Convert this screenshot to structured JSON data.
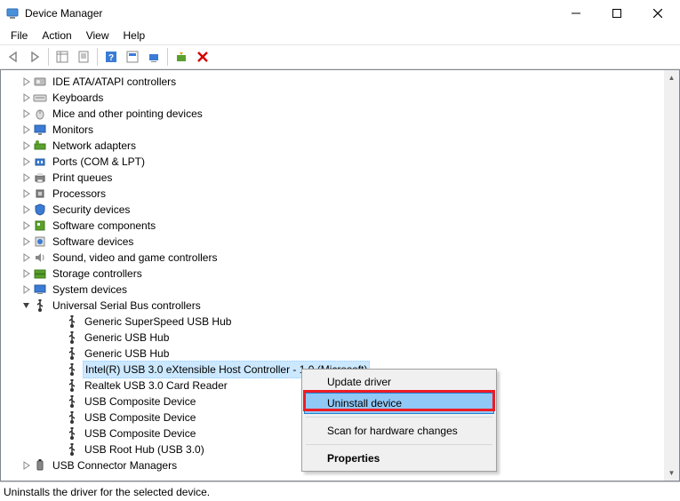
{
  "window": {
    "title": "Device Manager"
  },
  "menu": {
    "file": "File",
    "action": "Action",
    "view": "View",
    "help": "Help"
  },
  "tree": {
    "categories": [
      {
        "label": "IDE ATA/ATAPI controllers",
        "icon": "drive",
        "expanded": false
      },
      {
        "label": "Keyboards",
        "icon": "keyboard",
        "expanded": false
      },
      {
        "label": "Mice and other pointing devices",
        "icon": "mouse",
        "expanded": false
      },
      {
        "label": "Monitors",
        "icon": "monitor",
        "expanded": false
      },
      {
        "label": "Network adapters",
        "icon": "network",
        "expanded": false
      },
      {
        "label": "Ports (COM & LPT)",
        "icon": "port",
        "expanded": false
      },
      {
        "label": "Print queues",
        "icon": "printer",
        "expanded": false
      },
      {
        "label": "Processors",
        "icon": "processor",
        "expanded": false
      },
      {
        "label": "Security devices",
        "icon": "security",
        "expanded": false
      },
      {
        "label": "Software components",
        "icon": "component",
        "expanded": false
      },
      {
        "label": "Software devices",
        "icon": "software",
        "expanded": false
      },
      {
        "label": "Sound, video and game controllers",
        "icon": "sound",
        "expanded": false
      },
      {
        "label": "Storage controllers",
        "icon": "storage",
        "expanded": false
      },
      {
        "label": "System devices",
        "icon": "system",
        "expanded": false
      },
      {
        "label": "Universal Serial Bus controllers",
        "icon": "usb",
        "expanded": true,
        "children": [
          {
            "label": "Generic SuperSpeed USB Hub"
          },
          {
            "label": "Generic USB Hub"
          },
          {
            "label": "Generic USB Hub"
          },
          {
            "label": "Intel(R) USB 3.0 eXtensible Host Controller - 1.0 (Microsoft)",
            "selected": true
          },
          {
            "label": "Realtek USB 3.0 Card Reader"
          },
          {
            "label": "USB Composite Device"
          },
          {
            "label": "USB Composite Device"
          },
          {
            "label": "USB Composite Device"
          },
          {
            "label": "USB Root Hub (USB 3.0)"
          }
        ]
      },
      {
        "label": "USB Connector Managers",
        "icon": "usb-connector",
        "expanded": false
      }
    ]
  },
  "context_menu": {
    "items": [
      {
        "label": "Update driver"
      },
      {
        "label": "Uninstall device",
        "highlight": true
      },
      {
        "sep": true
      },
      {
        "label": "Scan for hardware changes"
      },
      {
        "sep": true
      },
      {
        "label": "Properties",
        "bold": true
      }
    ]
  },
  "statusbar": {
    "text": "Uninstalls the driver for the selected device."
  }
}
